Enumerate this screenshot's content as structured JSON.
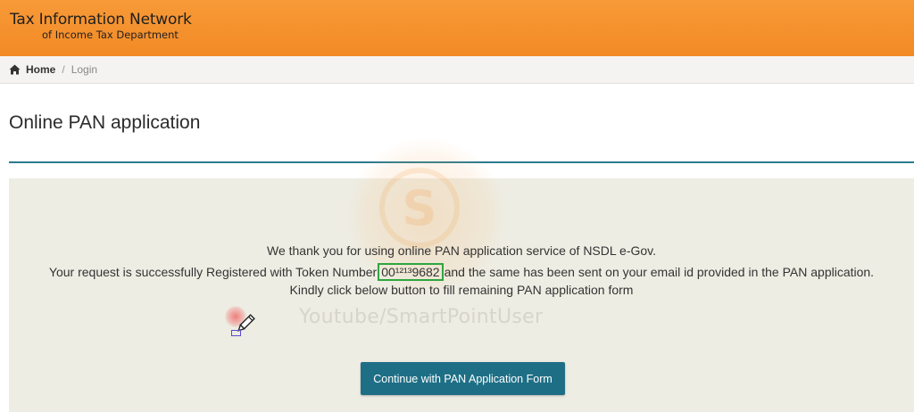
{
  "header": {
    "title": "Tax Information Network",
    "subtitle": "of Income Tax Department",
    "color": "#f28a25"
  },
  "breadcrumb": {
    "home_icon": "home-icon",
    "home": "Home",
    "separator": "/",
    "current": "Login"
  },
  "page": {
    "title": "Online PAN application"
  },
  "message": {
    "line1": "We thank you for using online PAN application service of NSDL e-Gov.",
    "line2_before": "Your request is successfully Registered with Token Number",
    "token": "00¹²¹³9682",
    "line2_after": "and the same has been sent on your email id provided in the PAN application.",
    "line3": "Kindly click below button to fill remaining PAN application form"
  },
  "watermark": {
    "text": "Youtube/SmartPointUser"
  },
  "actions": {
    "continue_label": "Continue with PAN Application Form",
    "color": "#1e6f86"
  }
}
